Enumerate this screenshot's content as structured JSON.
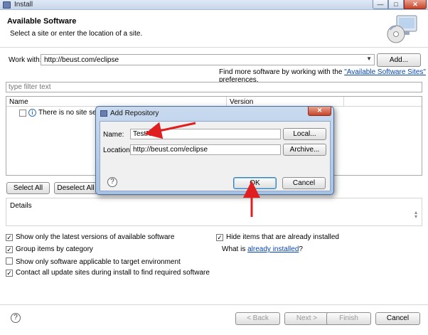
{
  "window": {
    "title": "Install",
    "controls": {
      "minimize": "—",
      "maximize": "□",
      "close": "✕"
    }
  },
  "header": {
    "title": "Available Software",
    "subtitle": "Select a site or enter the location of a site."
  },
  "workwith": {
    "label": "Work with:",
    "value": "http://beust.com/eclipse",
    "add_label": "Add...",
    "find_more_prefix": "Find more software by working with the ",
    "find_more_link": "\"Available Software Sites\"",
    "find_more_suffix": " preferences."
  },
  "filter": {
    "placeholder": "type filter text"
  },
  "table": {
    "columns": [
      "Name",
      "Version"
    ],
    "rows": [
      {
        "text": "There is no site selected."
      }
    ]
  },
  "buttons": {
    "select_all": "Select All",
    "deselect_all": "Deselect All"
  },
  "details": {
    "label": "Details"
  },
  "options": {
    "latest": {
      "label": "Show only the latest versions of available software",
      "checked": true
    },
    "group": {
      "label": "Group items by category",
      "checked": true
    },
    "target": {
      "label": "Show only software applicable to target environment",
      "checked": false
    },
    "contact": {
      "label": "Contact all update sites during install to find required software",
      "checked": true
    },
    "hide": {
      "label": "Hide items that are already installed",
      "checked": true
    },
    "what_is_prefix": "What is ",
    "what_is_link": "already installed",
    "what_is_suffix": "?"
  },
  "footer": {
    "help": "?",
    "back": "< Back",
    "next": "Next >",
    "finish": "Finish",
    "cancel": "Cancel"
  },
  "dialog": {
    "title": "Add Repository",
    "close": "✕",
    "name_label": "Name:",
    "name_value": "TestNG",
    "local_label": "Local...",
    "location_label": "Location:",
    "location_value": "http://beust.com/eclipse",
    "archive_label": "Archive...",
    "help": "?",
    "ok_label": "OK",
    "cancel_label": "Cancel"
  },
  "colors": {
    "dialog_frame": "#a8c2e3",
    "link": "#0645ad",
    "annotation_arrow": "#e02020"
  }
}
